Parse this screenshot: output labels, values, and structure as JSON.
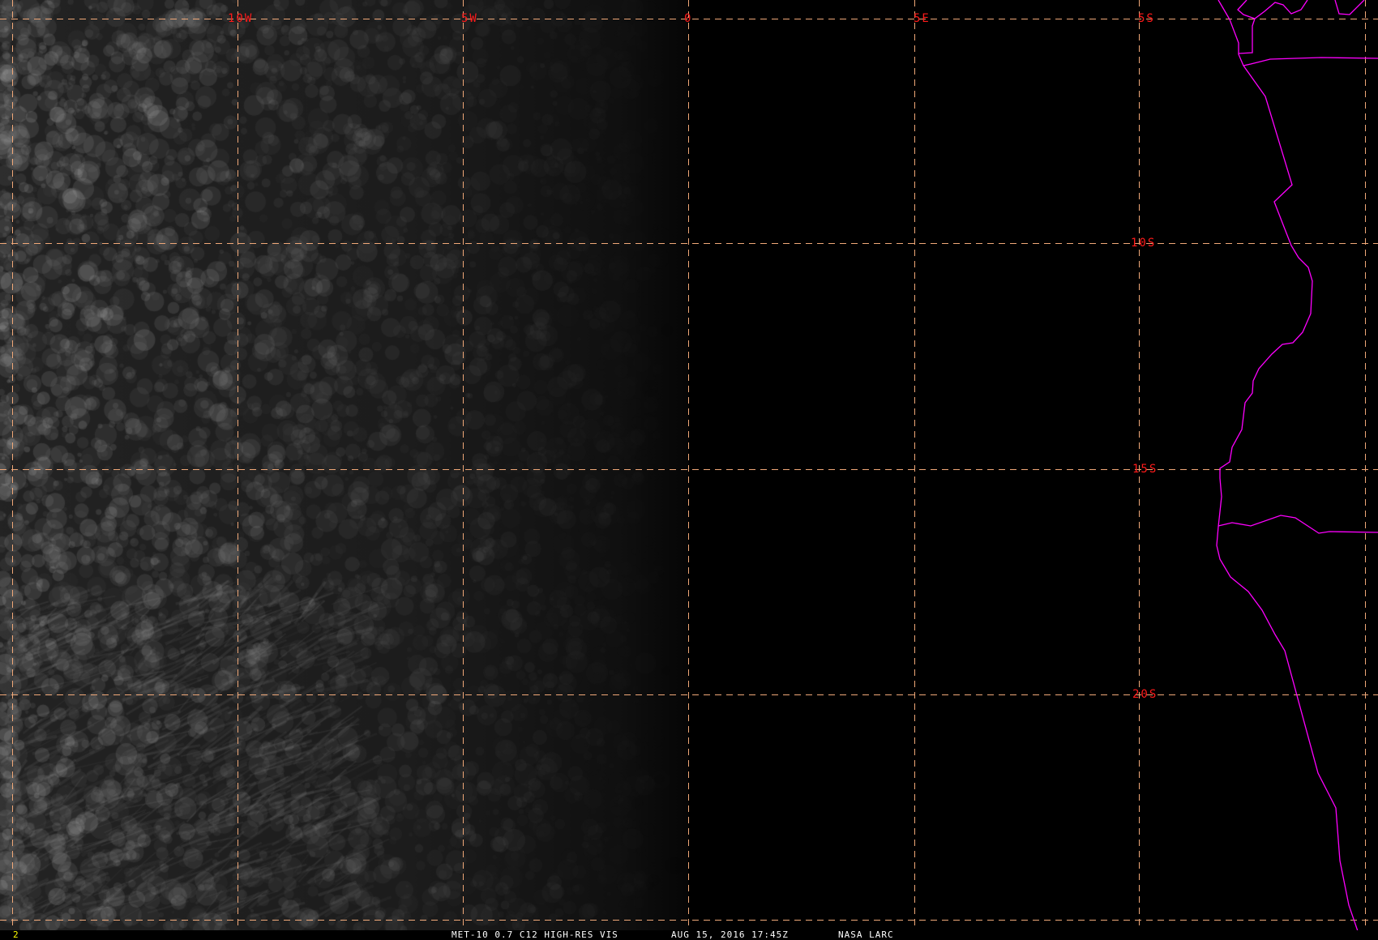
{
  "image": {
    "grid_color": "#f0a878",
    "label_color": "#ff1a1a",
    "coast_color": "#ff00ff",
    "lon_labels": [
      "10W",
      "5W",
      "0",
      "5E"
    ],
    "lat_labels": [
      "5S",
      "10S",
      "15S",
      "20S"
    ]
  },
  "footer": {
    "frame_number": "2",
    "product": "MET-10 0.7 C12 HIGH-RES VIS",
    "datetime": "AUG 15, 2016 17:45Z",
    "source": "NASA LARC"
  }
}
